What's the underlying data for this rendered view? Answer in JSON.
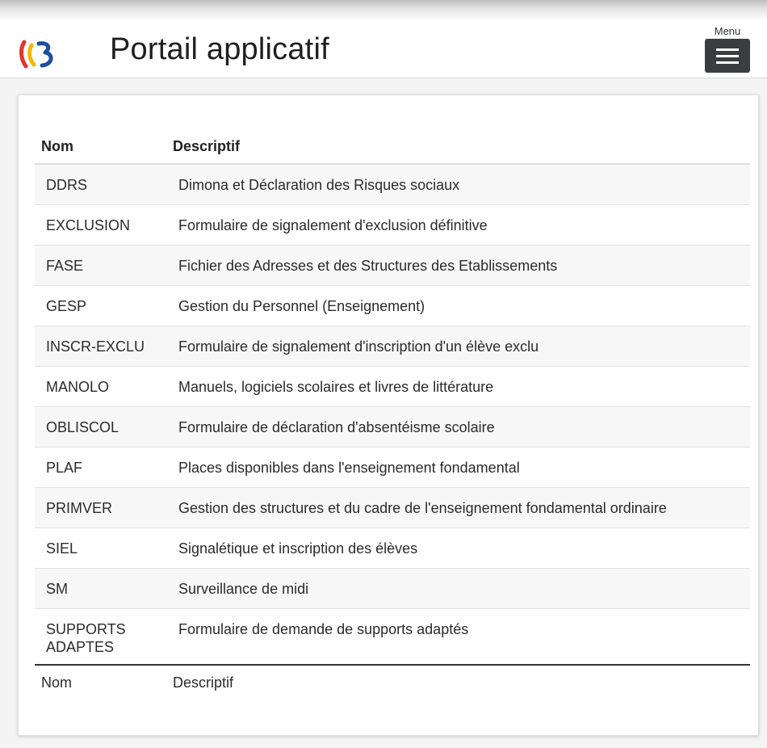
{
  "header": {
    "title": "Portail applicatif",
    "menu_label": "Menu",
    "logo_icon": "fwb-logo-icon",
    "menu_icon": "hamburger-icon"
  },
  "colors": {
    "logo_red": "#e3342f",
    "logo_yellow": "#f2b705",
    "logo_blue": "#1f4e9c",
    "menu_button": "#3a3d40"
  },
  "table": {
    "header": {
      "name": "Nom",
      "description": "Descriptif"
    },
    "footer": {
      "name": "Nom",
      "description": "Descriptif"
    },
    "rows": [
      {
        "name": "DDRS",
        "description": "Dimona et Déclaration des Risques sociaux"
      },
      {
        "name": "EXCLUSION",
        "description": "Formulaire de signalement d'exclusion définitive"
      },
      {
        "name": "FASE",
        "description": "Fichier des Adresses et des Structures des Etablissements"
      },
      {
        "name": "GESP",
        "description": "Gestion du Personnel (Enseignement)"
      },
      {
        "name": "INSCR-EXCLU",
        "description": "Formulaire de signalement d'inscription d'un élève exclu"
      },
      {
        "name": "MANOLO",
        "description": "Manuels, logiciels scolaires et livres de littérature"
      },
      {
        "name": "OBLISCOL",
        "description": "Formulaire de déclaration d'absentéisme scolaire"
      },
      {
        "name": "PLAF",
        "description": "Places disponibles dans l'enseignement fondamental"
      },
      {
        "name": "PRIMVER",
        "description": "Gestion des structures et du cadre de l'enseignement fondamental ordinaire"
      },
      {
        "name": "SIEL",
        "description": "Signalétique et inscription des élèves"
      },
      {
        "name": "SM",
        "description": "Surveillance de midi"
      },
      {
        "name": "SUPPORTS ADAPTES",
        "description": "Formulaire de demande de supports adaptés"
      }
    ]
  }
}
